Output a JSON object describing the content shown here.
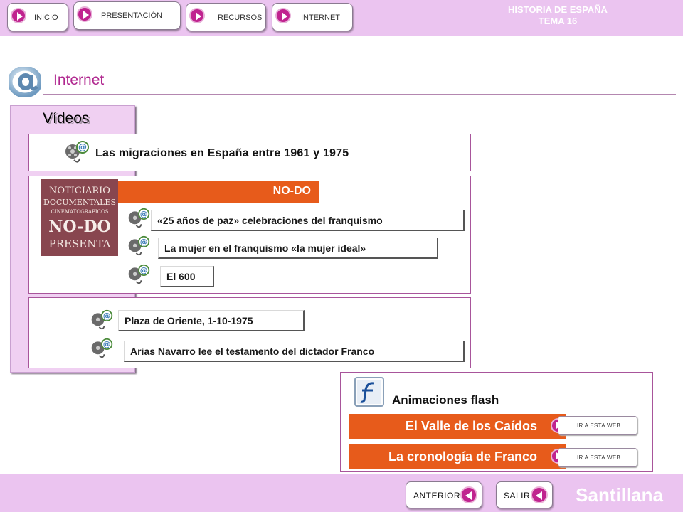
{
  "nav": {
    "items": [
      {
        "label": "INICIO"
      },
      {
        "label": "PRESENTACIÓN"
      },
      {
        "label": "RECURSOS"
      },
      {
        "label": "INTERNET"
      }
    ],
    "book_title_line1": "HISTORIA DE ESPAÑA",
    "book_title_line2": "TEMA 16"
  },
  "section": {
    "title": "Internet"
  },
  "videos": {
    "panel_title": "Vídeos",
    "migraciones_title": "Las migraciones en España entre 1961 y 1975",
    "nodo": {
      "band_label": "NO-DO",
      "image_text_lines": [
        "NOTICIARIO",
        "DOCUMENTALES",
        "CINEMATOGRAFICOS",
        "NO-DO",
        "PRESENTA"
      ],
      "links": [
        {
          "label": "«25 años de paz» celebraciones del franquismo"
        },
        {
          "label": "La mujer en el franquismo «la mujer ideal»"
        },
        {
          "label": "El 600"
        }
      ]
    },
    "other_links": [
      {
        "label": "Plaza de Oriente, 1-10-1975"
      },
      {
        "label": "Arias Navarro lee el testamento del dictador Franco"
      }
    ]
  },
  "animations": {
    "title": "Animaciones flash",
    "items": [
      {
        "label": "El Valle de los Caídos",
        "go_label": "IR A ESTA WEB"
      },
      {
        "label": "La cronología de Franco",
        "go_label": "IR A ESTA WEB"
      }
    ]
  },
  "footer": {
    "prev_label": "ANTERIOR",
    "exit_label": "SALIR",
    "brand": "Santillana"
  },
  "colors": {
    "bar_bg": "#ebc4f0",
    "accent_magenta": "#c0238f",
    "accent_orange": "#e75b1b",
    "title_color": "#b0278f"
  }
}
